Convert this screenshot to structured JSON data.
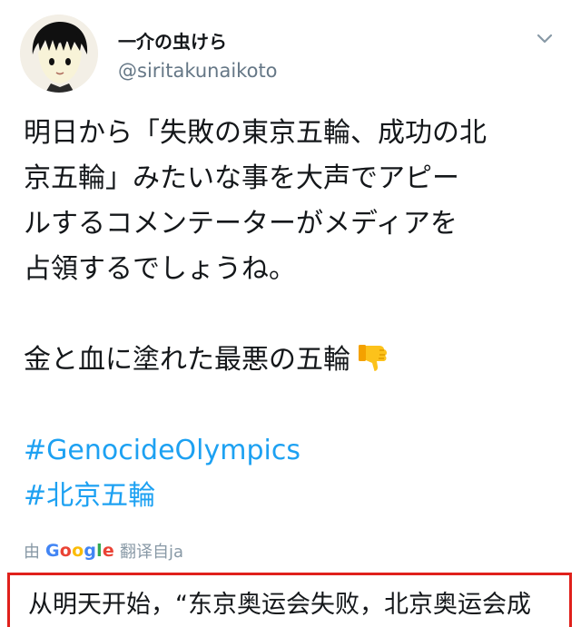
{
  "user": {
    "display_name": "一介の虫けら",
    "handle": "@siritakunaikoto"
  },
  "tweet": {
    "lines": [
      "明日から「失敗の東京五輪、成功の北",
      "京五輪」みたいな事を大声でアピー",
      "ルするコメンテーターがメディアを",
      "占領するでしょうね。",
      "",
      "金と血に塗れた最悪の五輪"
    ],
    "emoji": "thumbs-down",
    "hashtags": [
      "#GenocideOlympics",
      "#北京五輪"
    ]
  },
  "translation_credit": {
    "prefix": "由",
    "brand": "Google",
    "suffix": "翻译自ja"
  },
  "translation_text": "从明天开始，“东京奥运会失败，北京奥运会成",
  "colors": {
    "hashtag": "#1da1f2",
    "secondary_text": "#657786",
    "highlight_border": "#e0201b"
  },
  "icons": {
    "caret": "chevron-down-icon",
    "avatar": "avatar-cartoon",
    "emoji": "thumbs-down-icon"
  }
}
